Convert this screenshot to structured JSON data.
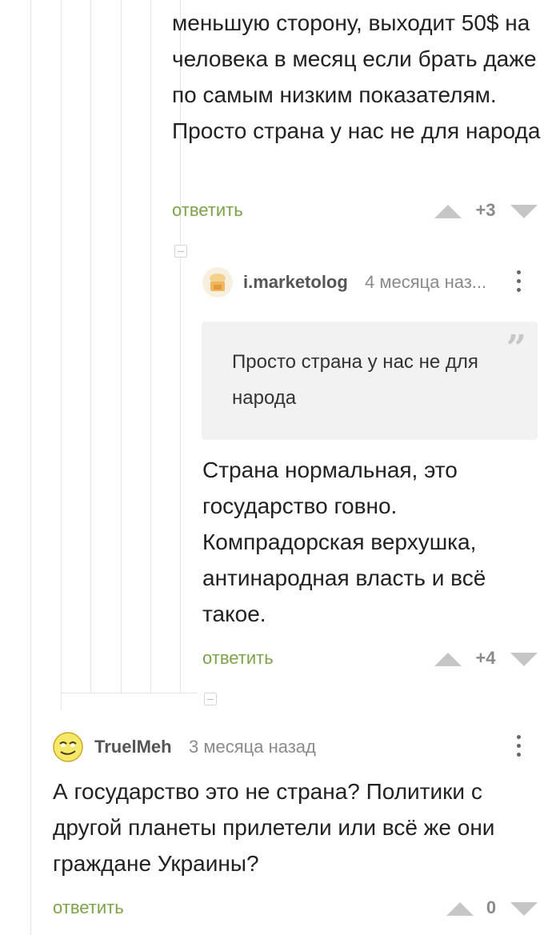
{
  "comment_1": {
    "text": "меньшую сторону, выходит 50$ на человека в месяц если брать даже по самым низким показателям. Просто страна у нас не для народа",
    "reply_label": "ответить",
    "score": "+3"
  },
  "comment_2": {
    "author": "i.marketolog",
    "time": "4 месяца наз...",
    "quote": "Просто страна у нас не для народа",
    "text": "Страна нормальная, это государство говно. Компрадорская верхушка, антинародная власть и всё такое.",
    "reply_label": "ответить",
    "score": "+4"
  },
  "comment_3": {
    "author": "TruelMeh",
    "time": "3 месяца назад",
    "text": "А государство это не страна? Политики с другой планеты прилетели или всё же они граждане Украины?",
    "reply_label": "ответить",
    "score": "0"
  },
  "icons": {
    "upvote": "triangle-up",
    "downvote": "triangle-down",
    "menu": "kebab-vertical",
    "collapse": "minus-square"
  },
  "colors": {
    "reply": "#7ea24a",
    "vote": "#c6c6c6",
    "quote_bg": "#f2f2f2"
  }
}
